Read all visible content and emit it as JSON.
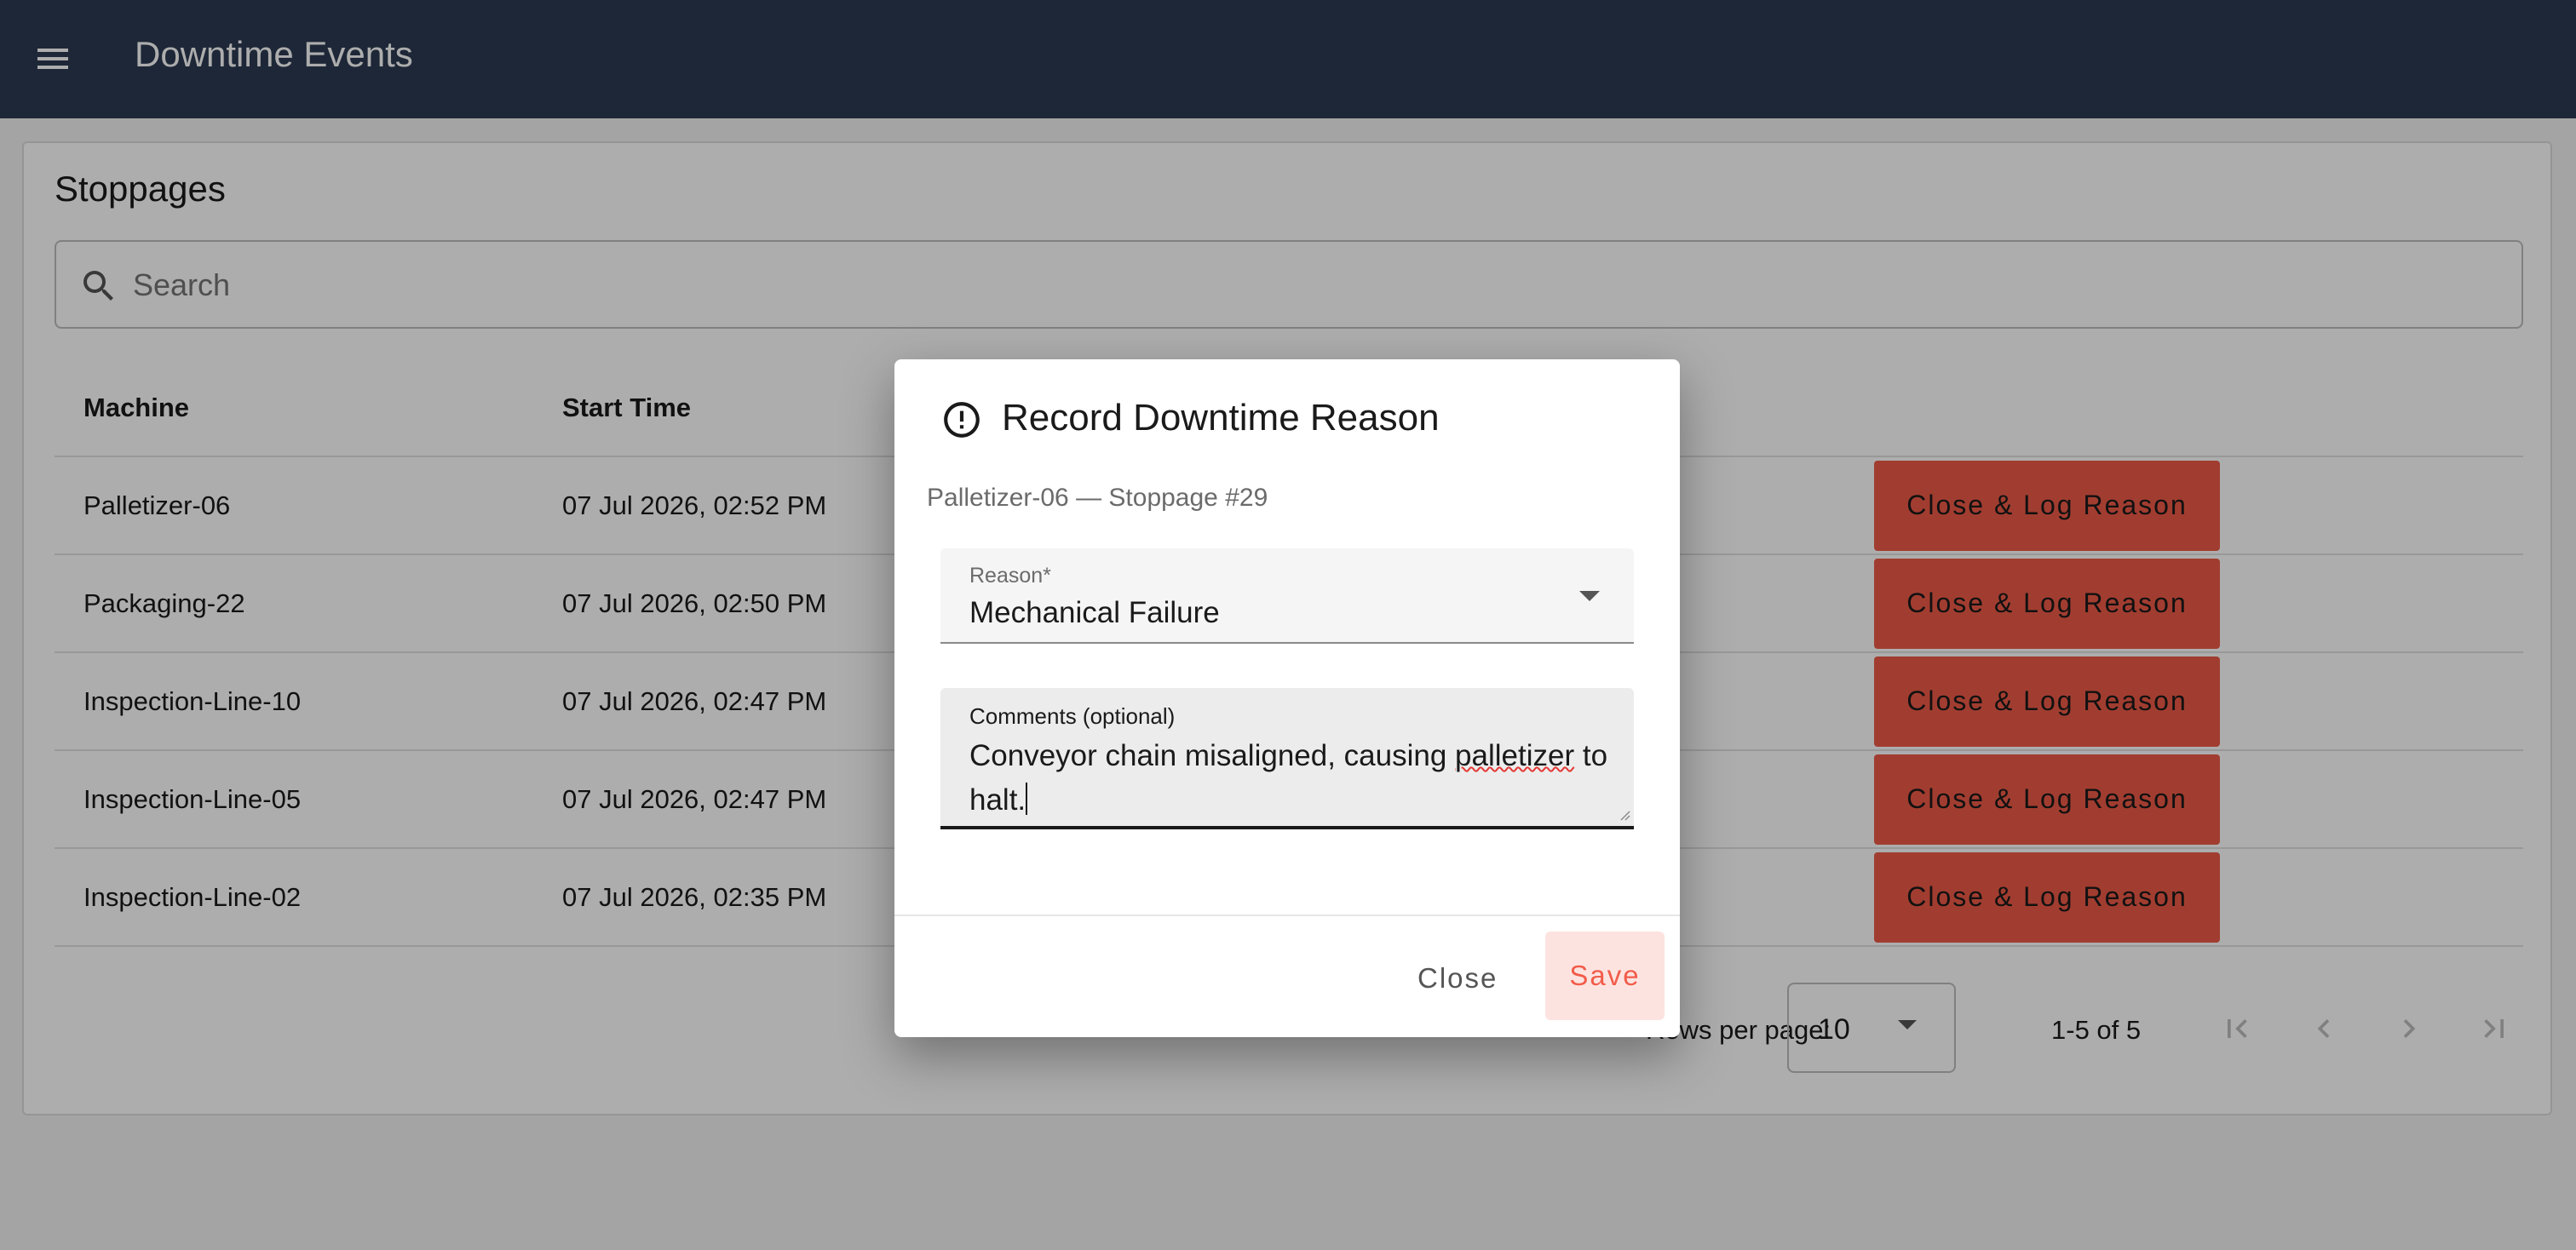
{
  "app": {
    "title": "Downtime Events"
  },
  "card": {
    "title": "Stoppages",
    "search_placeholder": "Search"
  },
  "table": {
    "columns": [
      "Machine",
      "Start Time"
    ],
    "rows": [
      {
        "machine": "Palletizer-06",
        "start_time": "07 Jul 2026, 02:52 PM",
        "action": "Close & Log Reason"
      },
      {
        "machine": "Packaging-22",
        "start_time": "07 Jul 2026, 02:50 PM",
        "action": "Close & Log Reason"
      },
      {
        "machine": "Inspection-Line-10",
        "start_time": "07 Jul 2026, 02:47 PM",
        "action": "Close & Log Reason"
      },
      {
        "machine": "Inspection-Line-05",
        "start_time": "07 Jul 2026, 02:47 PM",
        "action": "Close & Log Reason"
      },
      {
        "machine": "Inspection-Line-02",
        "start_time": "07 Jul 2026, 02:35 PM",
        "action": "Close & Log Reason"
      }
    ]
  },
  "pagination": {
    "rows_per_page_label": "Rows per page:",
    "rows_per_page_value": "10",
    "range": "1-5 of 5"
  },
  "dialog": {
    "title": "Record Downtime Reason",
    "subtitle": "Palletizer-06 — Stoppage #29",
    "reason_label": "Reason*",
    "reason_value": "Mechanical Failure",
    "comments_label": "Comments (optional)",
    "comments_before": "Conveyor chain misaligned, causing ",
    "comments_misspelled": "palletizer",
    "comments_after": " to halt.",
    "close_label": "Close",
    "save_label": "Save"
  },
  "colors": {
    "appbar": "#2b3a52",
    "danger_button": "#ee5a48",
    "save_text": "#f25c4a",
    "save_bg": "#fde3e0"
  },
  "icons": [
    "menu-icon",
    "search-icon",
    "alert-circle-icon",
    "first-page-icon",
    "chevron-left-icon",
    "chevron-right-icon",
    "last-page-icon"
  ]
}
